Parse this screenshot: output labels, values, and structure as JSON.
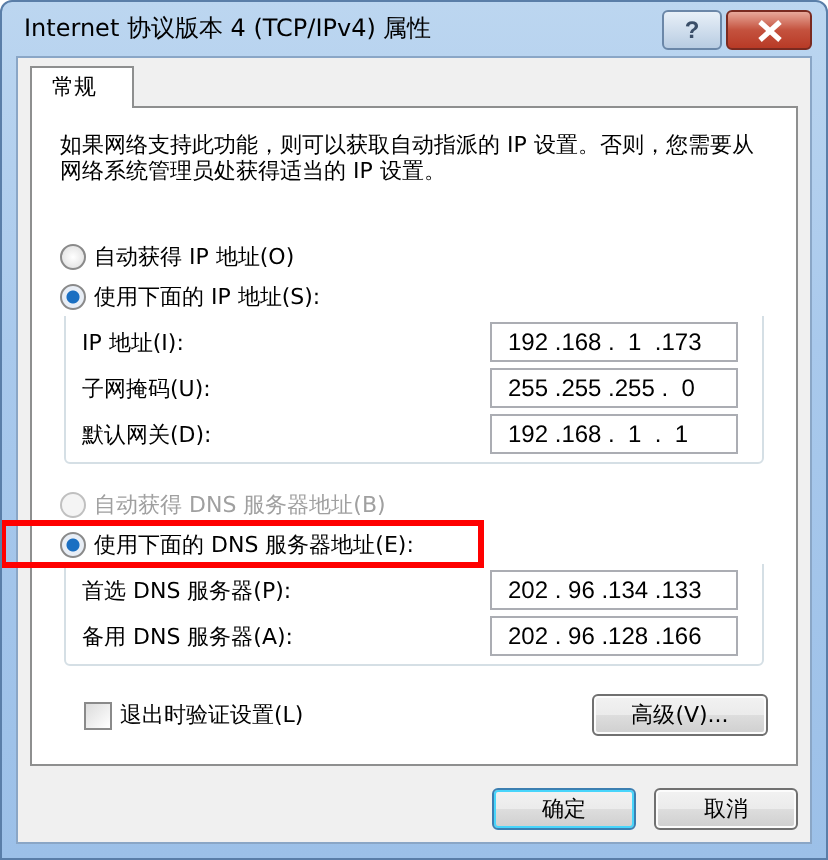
{
  "window": {
    "title": "Internet 协议版本 4 (TCP/IPv4) 属性",
    "help_button": "?"
  },
  "tabs": [
    {
      "label": "常规",
      "selected": true
    }
  ],
  "description": "如果网络支持此功能，则可以获取自动指派的 IP 设置。否则，您需要从网络系统管理员处获得适当的 IP 设置。",
  "ip_section": {
    "radios": [
      {
        "label": "自动获得 IP 地址(O)",
        "selected": false,
        "disabled": false,
        "highlighted": false
      },
      {
        "label": "使用下面的 IP 地址(S):",
        "selected": true,
        "disabled": false,
        "highlighted": false
      }
    ],
    "fields": [
      {
        "label": "IP 地址(I):",
        "value": "192 .168 .  1  .173"
      },
      {
        "label": "子网掩码(U):",
        "value": "255 .255 .255 .  0"
      },
      {
        "label": "默认网关(D):",
        "value": "192 .168 .  1  .  1"
      }
    ]
  },
  "dns_section": {
    "radios": [
      {
        "label": "自动获得 DNS 服务器地址(B)",
        "selected": false,
        "disabled": true,
        "highlighted": false
      },
      {
        "label": "使用下面的 DNS 服务器地址(E):",
        "selected": true,
        "disabled": false,
        "highlighted": true
      }
    ],
    "fields": [
      {
        "label": "首选 DNS 服务器(P):",
        "value": "202 . 96 .134 .133"
      },
      {
        "label": "备用 DNS 服务器(A):",
        "value": "202 . 96 .128 .166"
      }
    ]
  },
  "validate_checkbox": {
    "label": "退出时验证设置(L)",
    "checked": false
  },
  "advanced_button": "高级(V)...",
  "buttons": [
    {
      "label": "确定",
      "default": true
    },
    {
      "label": "取消",
      "default": false
    }
  ]
}
